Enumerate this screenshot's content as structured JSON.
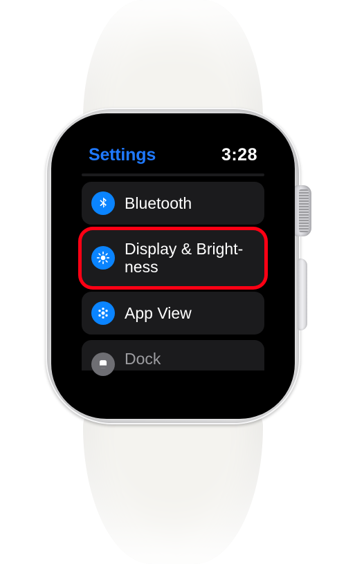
{
  "header": {
    "title": "Settings",
    "time": "3:28"
  },
  "rows": [
    {
      "icon": "bluetooth-icon",
      "label": "Bluetooth"
    },
    {
      "icon": "brightness-icon",
      "label": "Display & Bright­ness"
    },
    {
      "icon": "app-view-icon",
      "label": "App View"
    },
    {
      "icon": "dock-icon",
      "label": "Dock"
    }
  ],
  "highlight_index": 1,
  "colors": {
    "accent": "#1f79ff",
    "icon_bg": "#0a84ff",
    "row_bg": "#1b1b1d",
    "highlight": "#ff0014"
  }
}
